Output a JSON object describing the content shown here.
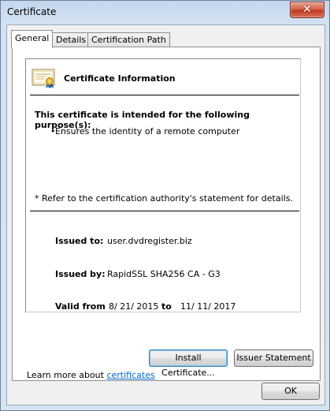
{
  "window": {
    "title": "Certificate"
  },
  "tabs": [
    {
      "label": "General",
      "active": true
    },
    {
      "label": "Details",
      "active": false
    },
    {
      "label": "Certification Path",
      "active": false
    }
  ],
  "info": {
    "title": "Certificate Information",
    "purpose_heading": "This certificate is intended for the following purpose(s):",
    "purposes": [
      "Ensures the identity of a remote computer"
    ],
    "bullet": "•",
    "footnote": "* Refer to the certification authority's statement for details."
  },
  "fields": {
    "issued_to_label": "Issued to:",
    "issued_to_value": "user.dvdregister.biz",
    "issued_by_label": "Issued by:",
    "issued_by_value": "RapidSSL SHA256 CA - G3",
    "valid_from_label": "Valid from",
    "valid_from_value": "8/ 21/ 2015",
    "to_label": "to",
    "valid_to_value": "11/ 11/ 2017"
  },
  "buttons": {
    "install": "Install Certificate...",
    "issuer": "Issuer Statement",
    "ok": "OK"
  },
  "learn_more": {
    "text": "Learn more about",
    "link": "certificates"
  },
  "colors": {
    "link": "#0066cc",
    "close_button": "#c0391f"
  },
  "icons": {
    "close": "close-icon",
    "certificate": "certificate-icon"
  }
}
